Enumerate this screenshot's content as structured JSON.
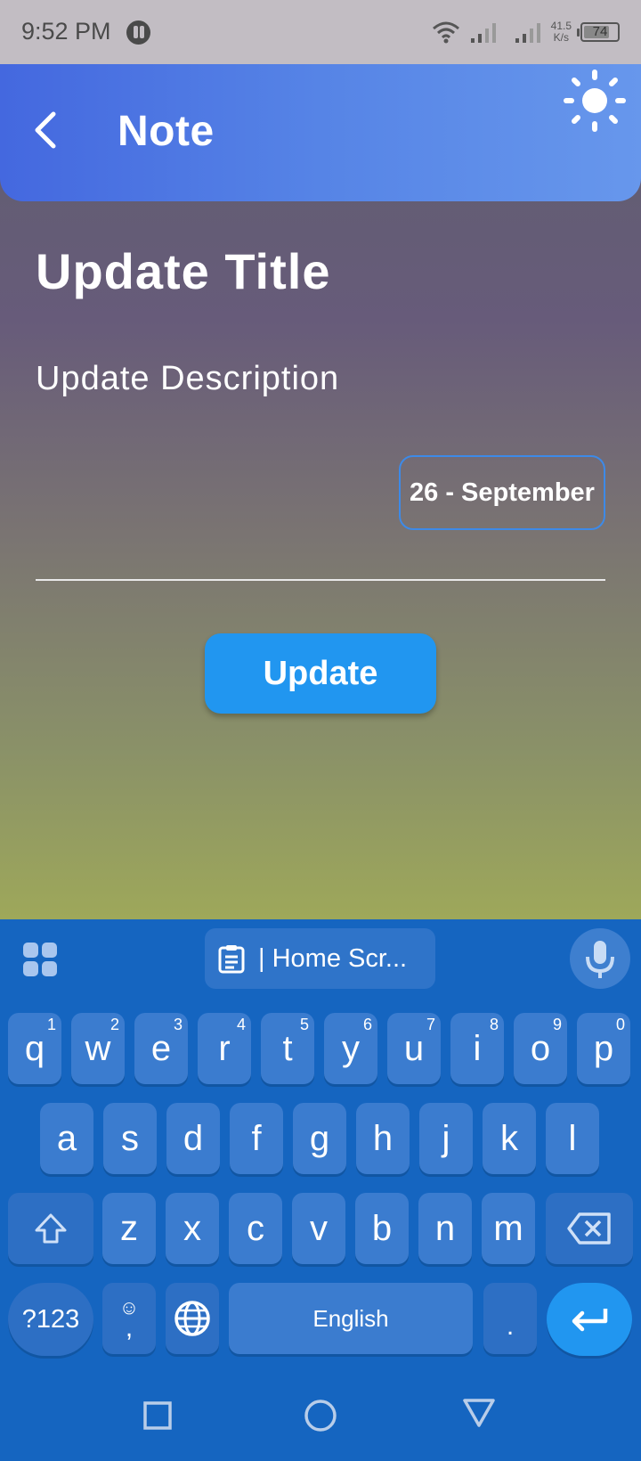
{
  "status_bar": {
    "time": "9:52 PM",
    "speed_value": "41.5",
    "speed_unit": "K/s",
    "battery": "74"
  },
  "app_bar": {
    "title": "Note",
    "back_icon": "chevron-left-icon",
    "theme_icon": "sun-icon"
  },
  "form": {
    "title": "Update Title",
    "description": "Update Description",
    "date": "26 - September",
    "button_label": "Update"
  },
  "keyboard": {
    "clipboard_text": "| Home Scr...",
    "row1": [
      {
        "k": "q",
        "h": "1"
      },
      {
        "k": "w",
        "h": "2"
      },
      {
        "k": "e",
        "h": "3"
      },
      {
        "k": "r",
        "h": "4"
      },
      {
        "k": "t",
        "h": "5"
      },
      {
        "k": "y",
        "h": "6"
      },
      {
        "k": "u",
        "h": "7"
      },
      {
        "k": "i",
        "h": "8"
      },
      {
        "k": "o",
        "h": "9"
      },
      {
        "k": "p",
        "h": "0"
      }
    ],
    "row2": [
      "a",
      "s",
      "d",
      "f",
      "g",
      "h",
      "j",
      "k",
      "l"
    ],
    "row3": [
      "z",
      "x",
      "c",
      "v",
      "b",
      "n",
      "m"
    ],
    "symbols_label": "?123",
    "emoji_comma": ",",
    "space_label": "English",
    "period": "."
  },
  "colors": {
    "app_bar_start": "#4468df",
    "app_bar_end": "#6797ec",
    "button": "#2196f0",
    "keyboard_bg": "#1565c0"
  }
}
